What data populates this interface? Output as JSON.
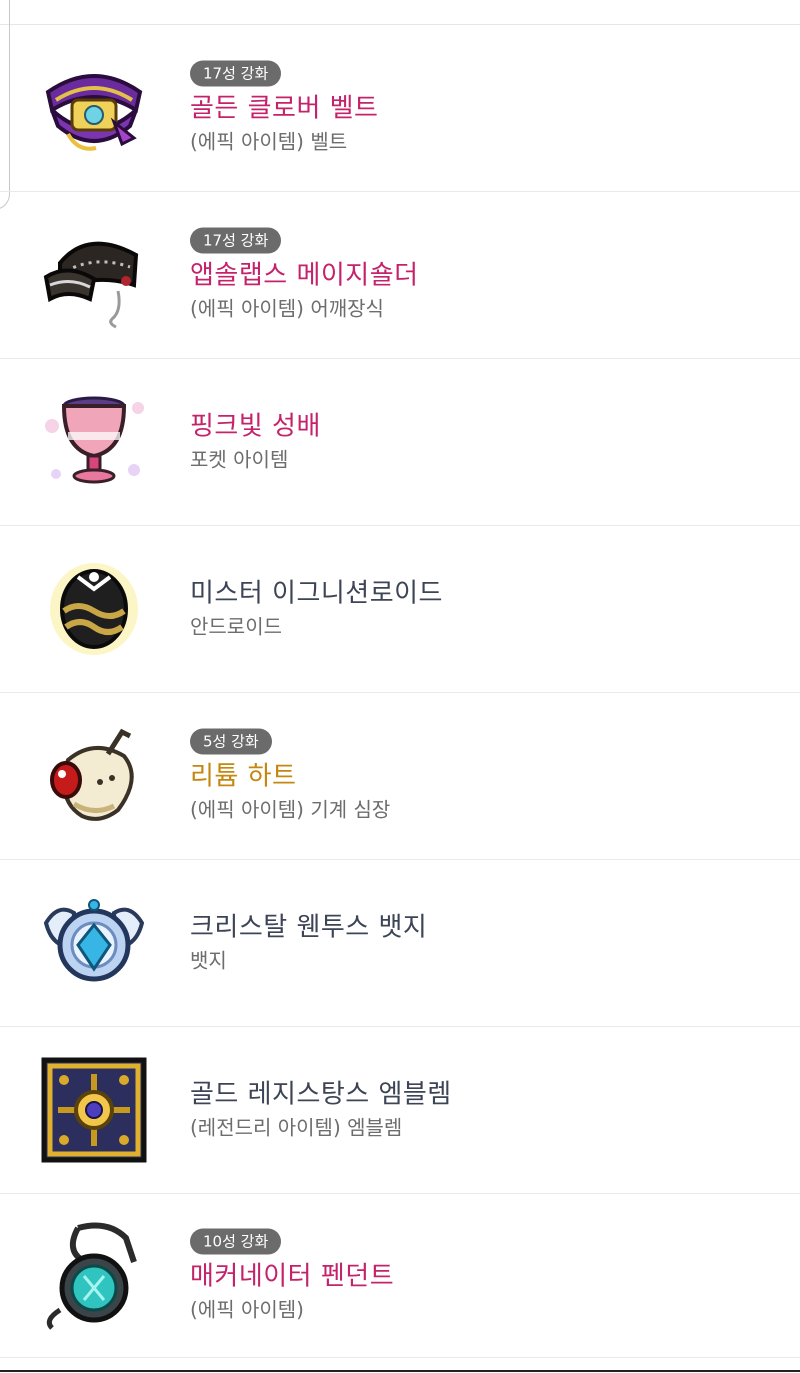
{
  "colors": {
    "epic": "#c4236b",
    "unique": "#c48710",
    "normal": "#3c4456",
    "badge_bg": "#6b6b6b",
    "sub_text": "#6d6d6d"
  },
  "items": [
    {
      "badge": "17성 강화",
      "name": "골든 클로버 벨트",
      "sub": "(에픽 아이템) 벨트",
      "grade": "epic",
      "icon": "golden-clover-belt-icon"
    },
    {
      "badge": "17성 강화",
      "name": "앱솔랩스 메이지숄더",
      "sub": "(에픽 아이템) 어깨장식",
      "grade": "epic",
      "icon": "absolab-mage-shoulder-icon"
    },
    {
      "badge": "",
      "name": "핑크빛 성배",
      "sub": "포켓 아이템",
      "grade": "epic",
      "icon": "pink-holy-cup-icon"
    },
    {
      "badge": "",
      "name": "미스터 이그니션로이드",
      "sub": "안드로이드",
      "grade": "normal",
      "icon": "android-egg-icon"
    },
    {
      "badge": "5성 강화",
      "name": "리튬 하트",
      "sub": "(에픽 아이템) 기계 심장",
      "grade": "unique",
      "icon": "lithium-heart-icon"
    },
    {
      "badge": "",
      "name": "크리스탈 웬투스 뱃지",
      "sub": "뱃지",
      "grade": "normal",
      "icon": "crystal-ventus-badge-icon"
    },
    {
      "badge": "",
      "name": "골드 레지스탕스 엠블렘",
      "sub": "(레전드리 아이템) 엠블렘",
      "grade": "normal",
      "icon": "gold-resistance-emblem-icon"
    },
    {
      "badge": "10성 강화",
      "name": "매커네이터 펜던트",
      "sub": "(에픽 아이템)",
      "grade": "epic",
      "icon": "mechanator-pendant-icon"
    }
  ]
}
